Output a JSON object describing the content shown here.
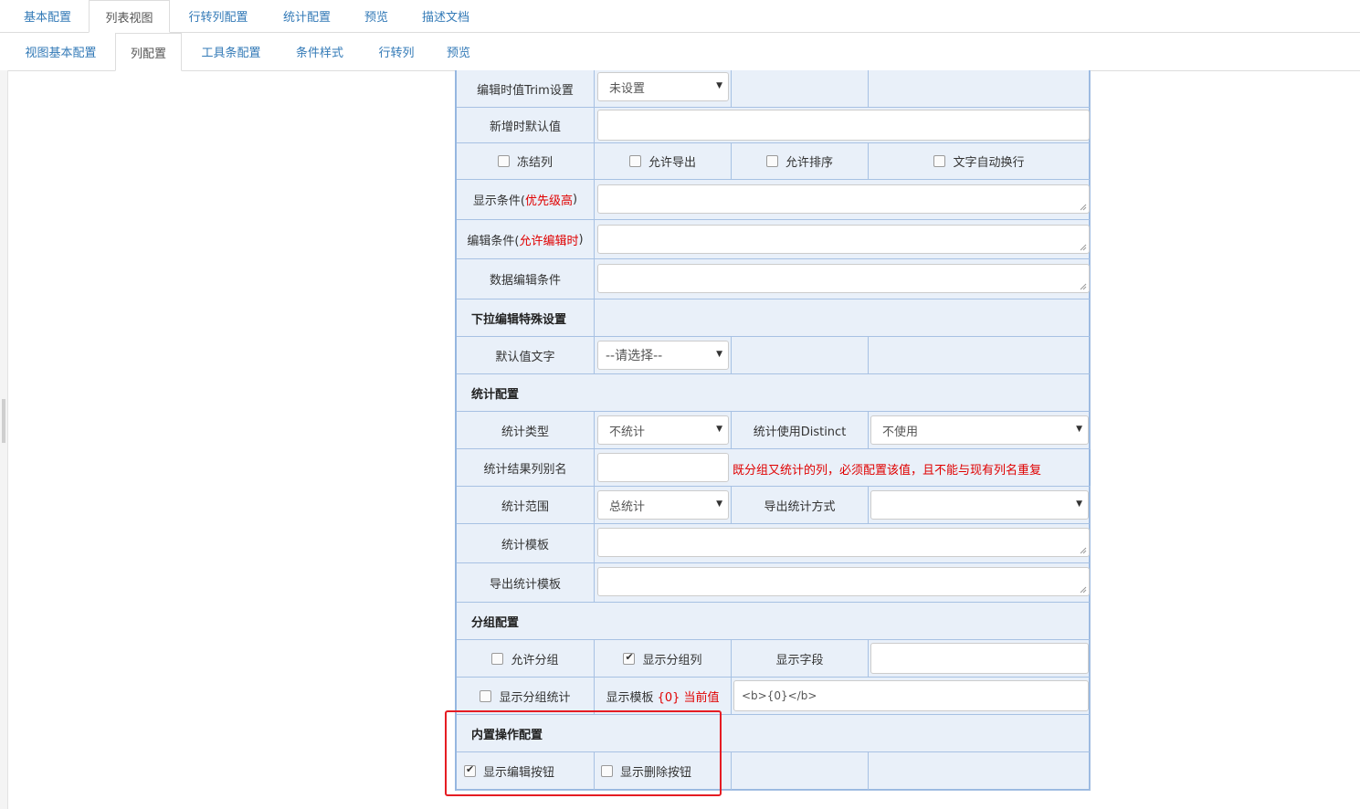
{
  "top_tabs": [
    "基本配置",
    "列表视图",
    "行转列配置",
    "统计配置",
    "预览",
    "描述文档"
  ],
  "sub_tabs": [
    "视图基本配置",
    "列配置",
    "工具条配置",
    "条件样式",
    "行转列",
    "预览"
  ],
  "rows": {
    "trim": {
      "label": "编辑时值Trim设置",
      "value": "未设置"
    },
    "default_value": {
      "label": "新增时默认值",
      "value": ""
    },
    "checkboxes": {
      "freeze": "冻结列",
      "export": "允许导出",
      "sort": "允许排序",
      "wrap": "文字自动换行"
    },
    "show_cond": {
      "label": "显示条件(",
      "highlight": "优先级高",
      "end": ")"
    },
    "edit_cond": {
      "label": "编辑条件(",
      "highlight": "允许编辑时",
      "end": ")"
    },
    "data_edit_cond": {
      "label": "数据编辑条件"
    },
    "dropdown_section": "下拉编辑特殊设置",
    "default_text": {
      "label": "默认值文字",
      "value": "--请选择--"
    },
    "stat_section": "统计配置",
    "stat_type": {
      "label": "统计类型",
      "value": "不统计"
    },
    "stat_distinct": {
      "label": "统计使用Distinct",
      "value": "不使用"
    },
    "stat_alias": {
      "label": "统计结果列别名",
      "value": "",
      "note": "既分组又统计的列，必须配置该值，且不能与现有列名重复"
    },
    "stat_range": {
      "label": "统计范围",
      "value": "总统计"
    },
    "export_stat_mode": {
      "label": "导出统计方式",
      "value": ""
    },
    "stat_template": {
      "label": "统计模板"
    },
    "export_stat_template": {
      "label": "导出统计模板"
    },
    "group_section": "分组配置",
    "allow_group": {
      "label": "允许分组",
      "checked": false
    },
    "show_group_col": {
      "label": "显示分组列",
      "checked": true
    },
    "show_field": {
      "label": "显示字段",
      "value": ""
    },
    "show_group_stat": {
      "label": "显示分组统计",
      "checked": false
    },
    "show_template": {
      "label": "显示模板",
      "highlight": "{0} 当前值",
      "value": "<b>{0}</b>"
    },
    "builtin_section": "内置操作配置",
    "show_edit_btn": {
      "label": "显示编辑按钮",
      "checked": true
    },
    "show_delete_btn": {
      "label": "显示删除按钮",
      "checked": false
    }
  }
}
